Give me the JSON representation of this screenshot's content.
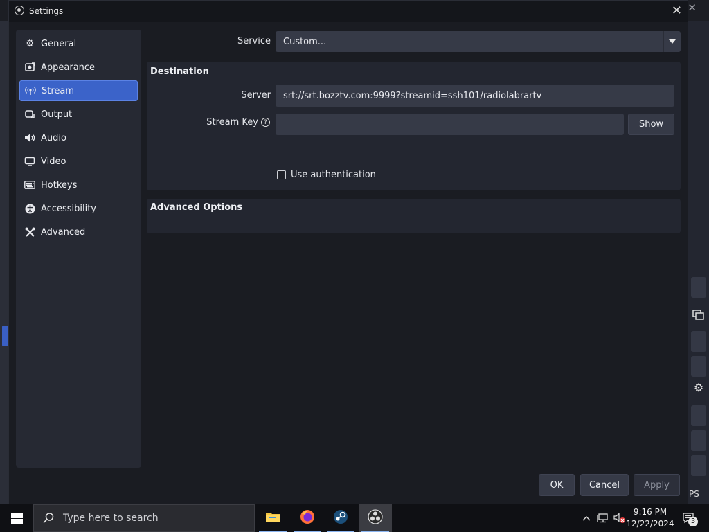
{
  "dialog": {
    "title": "Settings",
    "close_icon": "close-icon"
  },
  "sidebar": {
    "items": [
      {
        "label": "General",
        "icon": "gear-icon"
      },
      {
        "label": "Appearance",
        "icon": "appearance-icon"
      },
      {
        "label": "Stream",
        "icon": "antenna-icon",
        "active": true
      },
      {
        "label": "Output",
        "icon": "output-icon"
      },
      {
        "label": "Audio",
        "icon": "speaker-icon"
      },
      {
        "label": "Video",
        "icon": "monitor-icon"
      },
      {
        "label": "Hotkeys",
        "icon": "keyboard-icon"
      },
      {
        "label": "Accessibility",
        "icon": "accessibility-icon"
      },
      {
        "label": "Advanced",
        "icon": "tools-icon"
      }
    ]
  },
  "stream": {
    "service_label": "Service",
    "service_value": "Custom...",
    "destination_title": "Destination",
    "server_label": "Server",
    "server_value": "srt://srt.bozztv.com:9999?streamid=ssh101/radiolabrartv",
    "stream_key_label": "Stream Key",
    "stream_key_value": "",
    "show_button": "Show",
    "use_auth_label": "Use authentication",
    "use_auth_checked": false,
    "advanced_title": "Advanced Options"
  },
  "footer": {
    "ok": "OK",
    "cancel": "Cancel",
    "apply": "Apply"
  },
  "background": {
    "fps_text": "PS"
  },
  "taskbar": {
    "search_placeholder": "Type here to search",
    "time": "9:16 PM",
    "date": "12/22/2024",
    "notification_count": "3"
  },
  "colors": {
    "accent": "#3b63c9",
    "dialog_bg": "#1a1c22",
    "panel_bg": "#232630",
    "field_bg": "#363a47"
  }
}
